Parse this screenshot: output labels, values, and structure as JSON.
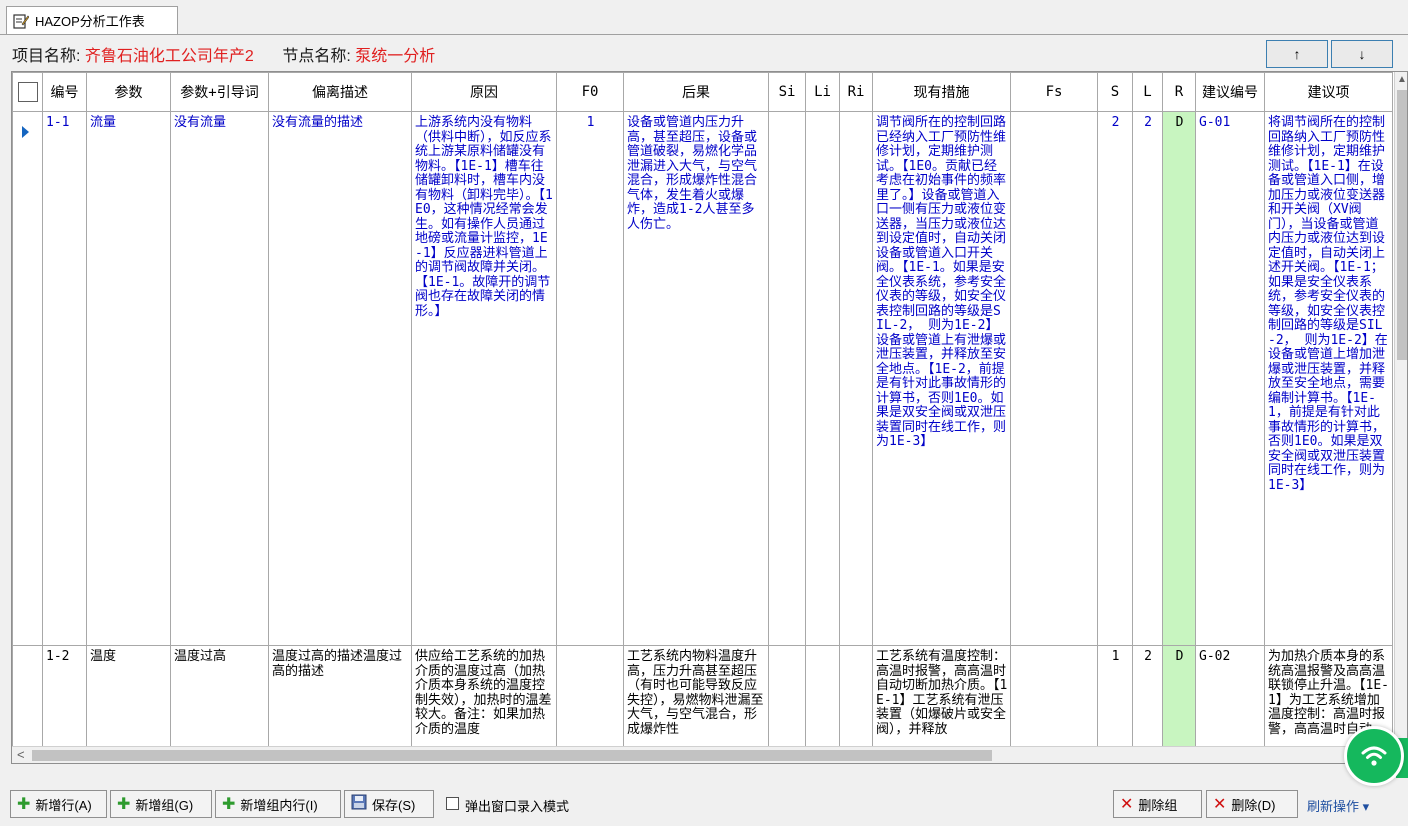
{
  "tab": {
    "title": "HAZOP分析工作表"
  },
  "info": {
    "project_label": "项目名称:",
    "project_value": "齐鲁石油化工公司年产2",
    "node_label": "节点名称:",
    "node_value": "泵统一分析"
  },
  "nav": {
    "up": "↑",
    "down": "↓"
  },
  "grid": {
    "columns": [
      "编号",
      "参数",
      "参数+引导词",
      "偏离描述",
      "原因",
      "F0",
      "后果",
      "Si",
      "Li",
      "Ri",
      "现有措施",
      "Fs",
      "S",
      "L",
      "R",
      "建议编号",
      "建议项"
    ],
    "rows": [
      {
        "id": "1-1",
        "param": "流量",
        "param_guide": "没有流量",
        "deviation": "没有流量的描述",
        "cause": "上游系统内没有物料（供料中断），如反应系统上游某原料储罐没有物料。【1E-1】槽车往储罐卸料时，槽车内没有物料（卸料完毕）。【1E0，这种情况经常会发生。如有操作人员通过地磅或流量计监控，1E-1】反应器进料管道上的调节阀故障并关闭。【1E-1。故障开的调节阀也存在故障关闭的情形。】",
        "f0": "1",
        "consequence": "设备或管道内压力升高，甚至超压，设备或管道破裂，易燃化学品泄漏进入大气，与空气混合，形成爆炸性混合气体，发生着火或爆炸，造成1-2人甚至多人伤亡。",
        "si": "",
        "li": "",
        "ri": "",
        "measures": "调节阀所在的控制回路已经纳入工厂预防性维修计划，定期维护测试。【1E0。贡献已经考虑在初始事件的频率里了。】设备或管道入口一侧有压力或液位变送器，当压力或液位达到设定值时，自动关闭设备或管道入口开关阀。【1E-1。如果是安全仪表系统，参考安全仪表的等级，如安全仪表控制回路的等级是SIL-2， 则为1E-2】设备或管道上有泄爆或泄压装置，并释放至安全地点。【1E-2，前提是有针对此事故情形的计算书，否则1E0。如果是双安全阀或双泄压装置同时在线工作，则为1E-3】",
        "fs": "",
        "s": "2",
        "l": "2",
        "r": "D",
        "rec_id": "G-01",
        "rec": "将调节阀所在的控制回路纳入工厂预防性维修计划，定期维护测试。【1E-1】在设备或管道入口侧，增加压力或液位变送器和开关阀（XV阀门），当设备或管道内压力或液位达到设定值时，自动关闭上述开关阀。【1E-1；如果是安全仪表系统，参考安全仪表的等级，如安全仪表控制回路的等级是SIL-2， 则为1E-2】在设备或管道上增加泄爆或泄压装置，并释放至安全地点，需要编制计算书。【1E-1，前提是有针对此事故情形的计算书，否则1E0。如果是双安全阀或双泄压装置同时在线工作，则为1E-3】"
      },
      {
        "id": "1-2",
        "param": "温度",
        "param_guide": "温度过高",
        "deviation": "温度过高的描述温度过高的描述",
        "cause": "供应给工艺系统的加热介质的温度过高（加热介质本身系统的温度控制失效），加热时的温差较大。备注：如果加热介质的温度",
        "f0": "",
        "consequence": "工艺系统内物料温度升高，压力升高甚至超压（有时也可能导致反应失控），易燃物料泄漏至大气，与空气混合，形成爆炸性",
        "si": "",
        "li": "",
        "ri": "",
        "measures": "工艺系统有温度控制：高温时报警，高高温时自动切断加热介质。【1E-1】工艺系统有泄压装置（如爆破片或安全阀），并释放",
        "fs": "",
        "s": "1",
        "l": "2",
        "r": "D",
        "rec_id": "G-02",
        "rec": "为加热介质本身的系统高温报警及高高温联锁停止升温。【1E-1】为工艺系统增加温度控制：高温时报警，高高温时自动"
      }
    ]
  },
  "toolbar": {
    "add_row": "新增行(A)",
    "add_group": "新增组(G)",
    "add_group_row": "新增组内行(I)",
    "save": "保存(S)",
    "popup_mode": "弹出窗口录入模式",
    "delete_group": "删除组",
    "delete": "删除(D)",
    "refresh": "刷新操作 ▾"
  },
  "colors": {
    "accent_red": "#e02020",
    "text_blue": "#0000c8",
    "risk_green": "#c8f5c0",
    "wifi_green": "#15b85d"
  }
}
